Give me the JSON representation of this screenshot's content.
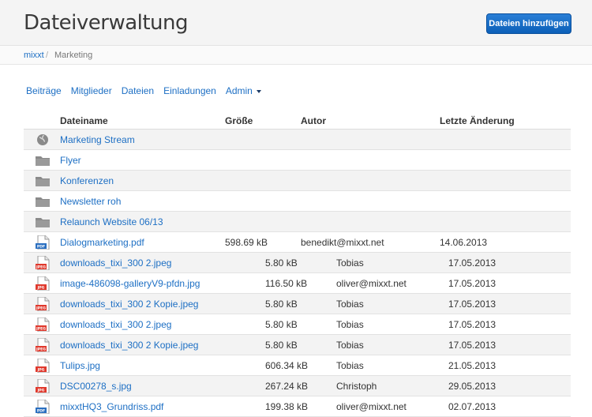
{
  "header": {
    "title": "Dateiverwaltung",
    "add_button": "Dateien hinzufügen"
  },
  "breadcrumb": {
    "root": "mixxt",
    "separator": "/",
    "current": "Marketing"
  },
  "nav": {
    "items": [
      "Beiträge",
      "Mitglieder",
      "Dateien",
      "Einladungen"
    ],
    "admin": "Admin"
  },
  "table": {
    "columns": {
      "name": "Dateiname",
      "size": "Größe",
      "author": "Autor",
      "modified": "Letzte Änderung"
    },
    "rows": [
      {
        "name": "Marketing Stream",
        "icon": "globe-icon",
        "size": "",
        "author": "",
        "date": ""
      },
      {
        "name": "Flyer",
        "icon": "folder-icon",
        "size": "",
        "author": "",
        "date": ""
      },
      {
        "name": "Konferenzen",
        "icon": "folder-icon",
        "size": "",
        "author": "",
        "date": ""
      },
      {
        "name": "Newsletter roh",
        "icon": "folder-icon",
        "size": "",
        "author": "",
        "date": ""
      },
      {
        "name": "Relaunch Website 06/13",
        "icon": "folder-icon",
        "size": "",
        "author": "",
        "date": ""
      },
      {
        "name": "Dialogmarketing.pdf",
        "icon": "pdf-file-icon",
        "size": "598.69 kB",
        "author": "benedikt@mixxt.net",
        "date": "14.06.2013"
      },
      {
        "name": "downloads_tixi_300 2.jpeg",
        "icon": "jpeg-file-icon",
        "size": "5.80 kB",
        "author": "Tobias",
        "date": "17.05.2013"
      },
      {
        "name": "image-486098-galleryV9-pfdn.jpg",
        "icon": "jpg-file-icon",
        "size": "116.50 kB",
        "author": "oliver@mixxt.net",
        "date": "17.05.2013"
      },
      {
        "name": "downloads_tixi_300 2 Kopie.jpeg",
        "icon": "jpeg-file-icon",
        "size": "5.80 kB",
        "author": "Tobias",
        "date": "17.05.2013"
      },
      {
        "name": "downloads_tixi_300 2.jpeg",
        "icon": "jpeg-file-icon",
        "size": "5.80 kB",
        "author": "Tobias",
        "date": "17.05.2013"
      },
      {
        "name": "downloads_tixi_300 2 Kopie.jpeg",
        "icon": "jpeg-file-icon",
        "size": "5.80 kB",
        "author": "Tobias",
        "date": "17.05.2013"
      },
      {
        "name": "Tulips.jpg",
        "icon": "jpg-file-icon",
        "size": "606.34 kB",
        "author": "Tobias",
        "date": "21.05.2013"
      },
      {
        "name": "DSC00278_s.jpg",
        "icon": "jpg-file-icon",
        "size": "267.24 kB",
        "author": "Christoph",
        "date": "29.05.2013"
      },
      {
        "name": "mixxtHQ3_Grundriss.pdf",
        "icon": "pdf-file-icon",
        "size": "199.38 kB",
        "author": "oliver@mixxt.net",
        "date": "02.07.2013"
      }
    ]
  },
  "colors": {
    "link": "#1d6fc4",
    "button": "#0b5fb8",
    "pdf": "#2a6fc0",
    "image_file": "#e0392d",
    "folder": "#8a8a8a"
  }
}
